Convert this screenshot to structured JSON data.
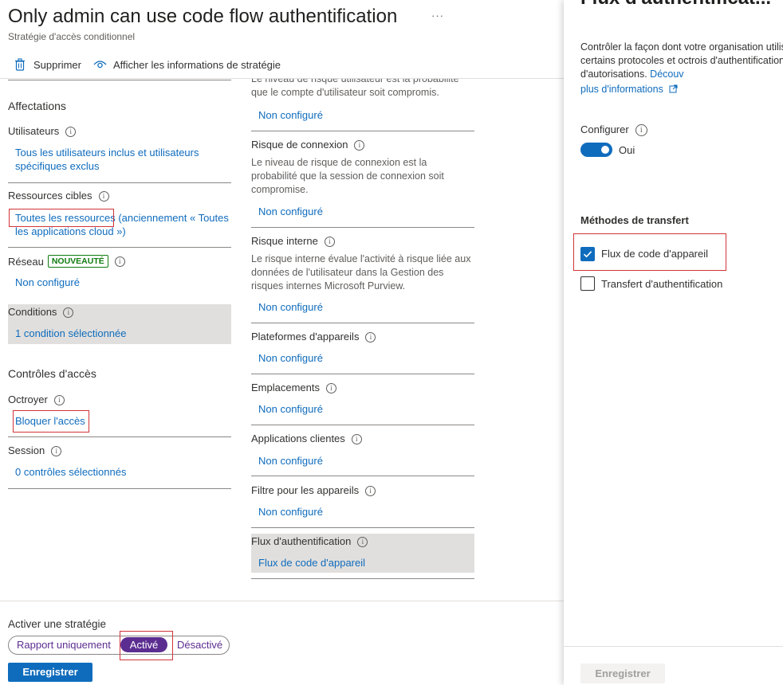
{
  "header": {
    "title": "Only admin can use code flow authentification",
    "more": "···",
    "subtitle": "Stratégie d'accès conditionnel"
  },
  "toolbar": {
    "delete_label": "Supprimer",
    "info_label": "Afficher les informations de stratégie"
  },
  "left": {
    "assignments_heading": "Affectations",
    "users_label": "Utilisateurs",
    "users_value": "Tous les utilisateurs inclus et utilisateurs spécifiques exclus",
    "resources_label": "Ressources cibles",
    "resources_link": "Toutes les ressources",
    "resources_extra": " (anciennement « Toutes les applications cloud »)",
    "network_label": "Réseau",
    "network_badge": "NOUVEAUTÉ",
    "network_value": "Non configuré",
    "conditions_label": "Conditions",
    "conditions_value": "1 condition sélectionnée",
    "access_heading": "Contrôles d'accès",
    "grant_label": "Octroyer",
    "grant_value": "Bloquer l'accès",
    "session_label": "Session",
    "session_value": "0 contrôles sélectionnés"
  },
  "middle": {
    "user_risk_desc": "Le niveau de risque utilisateur est la probabilité que le compte d'utilisateur soit compromis.",
    "user_risk_value": "Non configuré",
    "signin_risk_label": "Risque de connexion",
    "signin_risk_desc": "Le niveau de risque de connexion est la probabilité que la session de connexion soit compromise.",
    "signin_risk_value": "Non configuré",
    "insider_risk_label": "Risque interne",
    "insider_risk_desc": "Le risque interne évalue l'activité à risque liée aux données de l'utilisateur dans la Gestion des risques internes Microsoft Purview.",
    "insider_risk_value": "Non configuré",
    "platforms_label": "Plateformes d'appareils",
    "platforms_value": "Non configuré",
    "locations_label": "Emplacements",
    "locations_value": "Non configuré",
    "client_apps_label": "Applications clientes",
    "client_apps_value": "Non configuré",
    "device_filter_label": "Filtre pour les appareils",
    "device_filter_value": "Non configuré",
    "auth_flows_label": "Flux d'authentification",
    "auth_flows_value": "Flux de code d'appareil"
  },
  "bottom": {
    "enable_label": "Activer une stratégie",
    "options": [
      "Rapport uniquement",
      "Activé",
      "Désactivé"
    ],
    "selected": "Activé",
    "save_label": "Enregistrer"
  },
  "panel": {
    "title": "Flux d'authentificat...",
    "description": "Contrôler la façon dont votre organisation utilise certains protocoles et octrois d'authentification et d'autorisations.",
    "learn_more_a": "Découv",
    "learn_more_b": "plus d'informations",
    "configure_label": "Configurer",
    "toggle_value": "Oui",
    "toggle_on": true,
    "methods_heading": "Méthodes de transfert",
    "method_device_code": "Flux de code d'appareil",
    "method_device_code_checked": true,
    "method_auth_transfer": "Transfert d'authentification",
    "method_auth_transfer_checked": false,
    "save_label": "Enregistrer"
  },
  "colors": {
    "accent": "#0f6cbd",
    "highlight_red": "#d13438",
    "active_purple": "#5c2d91",
    "badge_green": "#107c10"
  }
}
